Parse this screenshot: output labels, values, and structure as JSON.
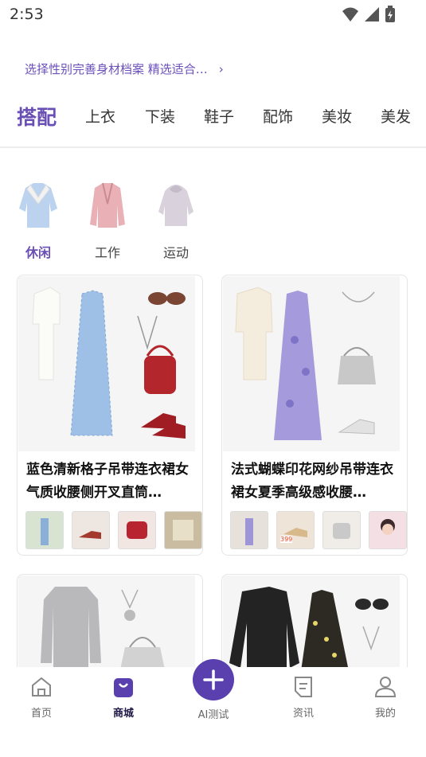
{
  "status_bar": {
    "time": "2:53"
  },
  "banner": {
    "text": "选择性别完善身材档案 精选适合…",
    "arrow": "›"
  },
  "category_tabs": [
    "搭配",
    "上衣",
    "下装",
    "鞋子",
    "配饰",
    "美妆",
    "美发"
  ],
  "style_filters": [
    "休闲",
    "工作",
    "运动"
  ],
  "cards": [
    {
      "title": "蓝色清新格子吊带连衣裙女气质收腰侧开叉直筒…"
    },
    {
      "title": "法式蝴蝶印花网纱吊带连衣裙女夏季高级感收腰…",
      "thumb_price": "399"
    },
    {
      "title": ""
    },
    {
      "title": ""
    }
  ],
  "bottom_nav": {
    "home": "首页",
    "mall": "商城",
    "ai": "AI测试",
    "news": "资讯",
    "mine": "我的"
  },
  "colors": {
    "accent": "#6a4fb5",
    "ai_button": "#5a3fae",
    "nav_active": "#1f1846"
  }
}
